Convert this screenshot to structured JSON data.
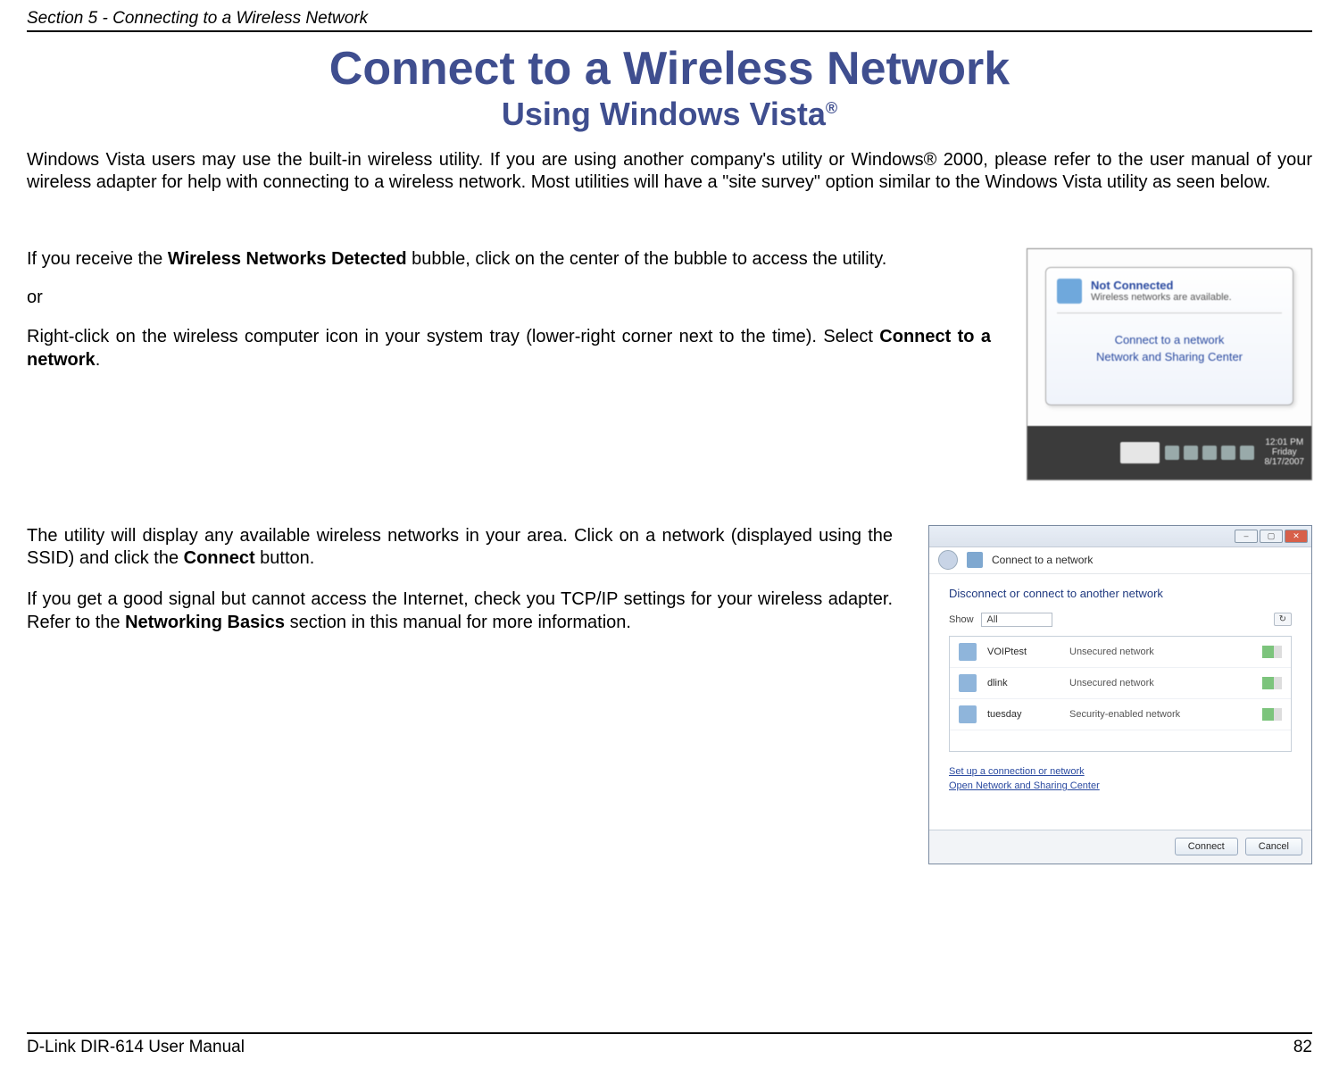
{
  "header": {
    "section": "Section 5 - Connecting to a Wireless Network"
  },
  "title": "Connect to a Wireless Network",
  "subtitle_main": "Using Windows Vista",
  "subtitle_reg": "®",
  "intro": "Windows Vista users may use the built-in wireless utility. If you are using another company's utility or Windows® 2000, please refer to the user manual of your wireless adapter for help with connecting to a wireless network. Most utilities will have a \"site survey\" option similar to the Windows Vista utility as seen below.",
  "block1": {
    "p1_pre": "If you receive the ",
    "p1_bold": "Wireless Networks Detected",
    "p1_post": " bubble, click on the center of the bubble to access the utility.",
    "or": "or",
    "p2_pre": "Right-click on the wireless computer icon in your system tray (lower-right corner next to the time). Select ",
    "p2_bold": "Connect to a network",
    "p2_post": "."
  },
  "tooltip": {
    "title": "Not Connected",
    "subtitle": "Wireless networks are available.",
    "link1": "Connect to a network",
    "link2": "Network and Sharing Center"
  },
  "tray": {
    "time": "12:01 PM",
    "day": "Friday",
    "date": "8/17/2007"
  },
  "block2": {
    "p1_pre": "The utility will display any available wireless networks in your area. Click on a network (displayed using the SSID) and click the ",
    "p1_bold": "Connect",
    "p1_post": " button.",
    "p2_pre": "If you get a good signal but cannot access the Internet, check you TCP/IP settings for your wireless adapter. Refer to the ",
    "p2_bold": "Networking Basics",
    "p2_post": " section in this manual for more information."
  },
  "dialog": {
    "nav_title": "Connect to a network",
    "body_title": "Disconnect or connect to another network",
    "show_label": "Show",
    "show_value": "All",
    "refresh": "↻",
    "networks": [
      {
        "name": "VOIPtest",
        "status": "Unsecured network"
      },
      {
        "name": "dlink",
        "status": "Unsecured network"
      },
      {
        "name": "tuesday",
        "status": "Security-enabled network"
      }
    ],
    "link1": "Set up a connection or network",
    "link2": "Open Network and Sharing Center",
    "btn_connect": "Connect",
    "btn_cancel": "Cancel"
  },
  "footer": {
    "left": "D-Link DIR-614 User Manual",
    "right": "82"
  }
}
